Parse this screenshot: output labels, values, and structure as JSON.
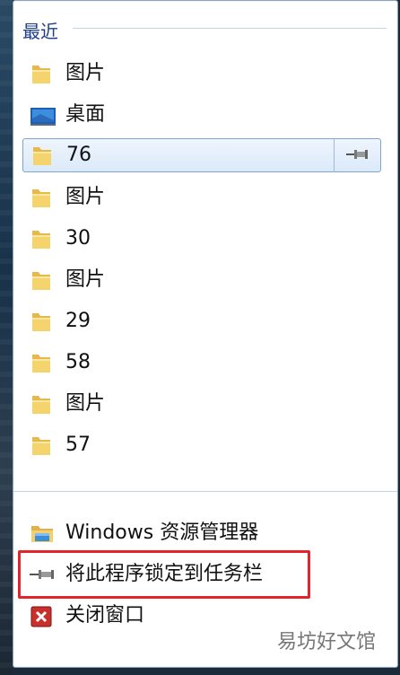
{
  "recent_section": {
    "title": "最近"
  },
  "recent_items": [
    {
      "label": "图片",
      "icon": "folder-icon"
    },
    {
      "label": "桌面",
      "icon": "desktop-icon"
    },
    {
      "label": "76",
      "icon": "folder-icon",
      "hovered": true,
      "pin_icon": "pin-icon"
    },
    {
      "label": "图片",
      "icon": "folder-icon"
    },
    {
      "label": "30",
      "icon": "folder-icon"
    },
    {
      "label": "图片",
      "icon": "folder-icon"
    },
    {
      "label": "29",
      "icon": "folder-icon"
    },
    {
      "label": "58",
      "icon": "folder-icon"
    },
    {
      "label": "图片",
      "icon": "folder-icon"
    },
    {
      "label": "57",
      "icon": "folder-icon"
    }
  ],
  "tasks": [
    {
      "label": "Windows 资源管理器",
      "icon": "explorer-icon"
    },
    {
      "label": "将此程序锁定到任务栏",
      "icon": "pin-icon"
    },
    {
      "label": "关闭窗口",
      "icon": "close-window-icon"
    }
  ],
  "watermark": "易坊好文馆",
  "colors": {
    "highlight": "#e5232a",
    "accent": "#1e3d8c",
    "hover_border": "#7fa4d4"
  }
}
